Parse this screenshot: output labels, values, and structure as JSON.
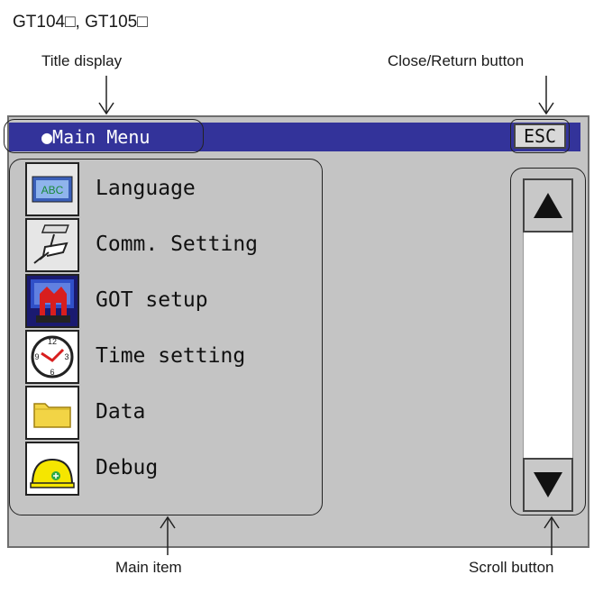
{
  "doc_title": "GT104□, GT105□",
  "callouts": {
    "title_display": "Title display",
    "close_return": "Close/Return button",
    "main_item": "Main item",
    "scroll_button": "Scroll button"
  },
  "screen": {
    "title": "●Main Menu",
    "esc_label": "ESC",
    "menu_items": [
      {
        "label": "Language",
        "icon": "language-abc-icon"
      },
      {
        "label": "Comm. Setting",
        "icon": "comm-cable-icon"
      },
      {
        "label": "GOT setup",
        "icon": "got-setup-icon"
      },
      {
        "label": "Time setting",
        "icon": "clock-icon"
      },
      {
        "label": "Data",
        "icon": "folder-icon"
      },
      {
        "label": "Debug",
        "icon": "helmet-icon"
      }
    ],
    "scroll": {
      "up_icon": "triangle-up-icon",
      "down_icon": "triangle-down-icon"
    }
  },
  "colors": {
    "titlebar": "#33339a",
    "screen_bg": "#c4c4c4",
    "abc_text": "#1a8a3a",
    "folder": "#f2d445",
    "helmet": "#f5e600"
  }
}
